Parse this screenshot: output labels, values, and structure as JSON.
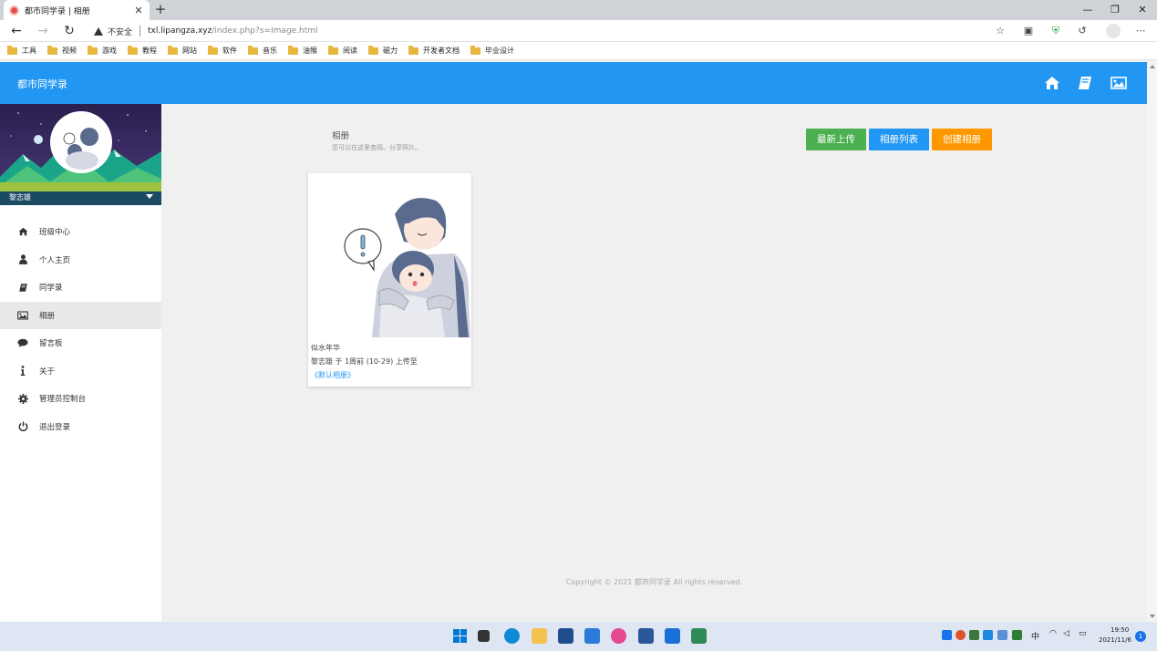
{
  "browser": {
    "tab_title": "都市同学录 | 相册",
    "tab_close": "✕",
    "new_tab": "+",
    "insecure_label": "不安全",
    "url_host": "txl.lipangza.xyz",
    "url_path": "/index.php?s=Image.html",
    "bookmarks": [
      "工具",
      "视频",
      "游戏",
      "教程",
      "网站",
      "软件",
      "音乐",
      "油猴",
      "阅读",
      "磁力",
      "开发者文档",
      "毕业设计"
    ],
    "folder_color": "#e8b73e"
  },
  "header": {
    "brand": "都市同学录",
    "color": "#2196f3"
  },
  "sidebar": {
    "user_name": "黎志雄",
    "items": [
      {
        "label": "班级中心",
        "icon": "home-icon",
        "active": false
      },
      {
        "label": "个人主页",
        "icon": "user-icon",
        "active": false
      },
      {
        "label": "同学录",
        "icon": "book-icon",
        "active": false
      },
      {
        "label": "相册",
        "icon": "image-icon",
        "active": true
      },
      {
        "label": "留言板",
        "icon": "comment-icon",
        "active": false
      },
      {
        "label": "关于",
        "icon": "info-icon",
        "active": false
      },
      {
        "label": "管理员控制台",
        "icon": "gear-icon",
        "active": false
      },
      {
        "label": "退出登录",
        "icon": "power-icon",
        "active": false
      }
    ]
  },
  "main": {
    "title": "相册",
    "subtitle": "您可以在这里查阅、分享照片。",
    "buttons": {
      "latest": "最新上传",
      "album_list": "相册列表",
      "create_album": "创建相册"
    },
    "button_colors": {
      "green": "#4caf50",
      "blue": "#2196f3",
      "orange": "#ff9800"
    },
    "photo": {
      "title": "似水年华",
      "meta": "黎志雄 于 1周前 (10-29) 上传至",
      "album": "《默认相册》"
    },
    "footer": "Copyright © 2021 都市同学录 All rights reserved."
  },
  "taskbar": {
    "ime": "中",
    "time": "19:50",
    "date": "2021/11/6",
    "notifications": "1"
  }
}
